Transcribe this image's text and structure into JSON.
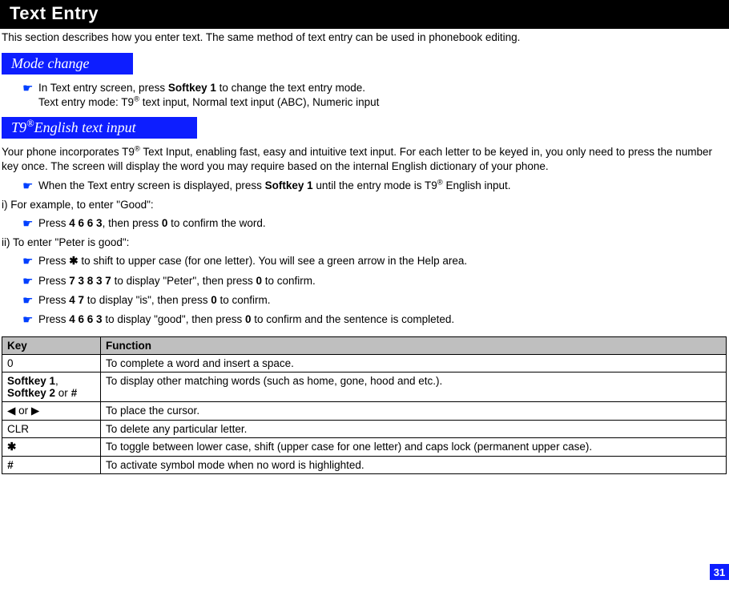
{
  "title": "Text Entry",
  "intro": "This section describes how you enter text. The same method of text entry can be used in phonebook editing.",
  "section1": {
    "heading": "Mode change"
  },
  "modechange": {
    "line1_a": "In Text entry screen, press ",
    "line1_b": "Softkey 1",
    "line1_c": " to change the text entry mode.",
    "line2": "Text entry mode: T9",
    "line2_sup": "®",
    "line2_tail": " text input, Normal text input (ABC), Numeric input"
  },
  "section2": {
    "heading_a": "T9",
    "heading_sup": "®",
    "heading_b": "English text input"
  },
  "t9_intro_a": "Your phone incorporates T9",
  "t9_intro_sup": "®",
  "t9_intro_b": " Text Input, enabling fast, easy and intuitive text input. For each letter to be keyed in, you only need to press the number key once. The screen will display the word you may require based on the internal English dictionary of your phone.",
  "t9_bullet1_a": "When the Text entry screen is displayed, press ",
  "t9_bullet1_b": "Softkey 1",
  "t9_bullet1_c": " until the entry mode is T9",
  "t9_bullet1_sup": "®",
  "t9_bullet1_d": " English input.",
  "ex_i": "i) For example, to enter \"Good\":",
  "ex_i_b1_a": " Press ",
  "ex_i_b1_b": "4 6 6 3",
  "ex_i_b1_c": ", then press ",
  "ex_i_b1_d": "0",
  "ex_i_b1_e": " to confirm the word.",
  "ex_ii": "ii) To enter \"Peter is good\":",
  "ex_ii_b1_a": "Press ",
  "ex_ii_b1_star": "✱",
  "ex_ii_b1_b": " to shift to upper case (for one letter). You will see a green arrow in the Help area.",
  "ex_ii_b2_a": "Press ",
  "ex_ii_b2_b": "7 3 8 3 7",
  "ex_ii_b2_c": " to display \"Peter\", then press ",
  "ex_ii_b2_d": "0",
  "ex_ii_b2_e": " to confirm.",
  "ex_ii_b3_a": "Press ",
  "ex_ii_b3_b": "4 7",
  "ex_ii_b3_c": " to display \"is\", then press ",
  "ex_ii_b3_d": "0",
  "ex_ii_b3_e": " to confirm.",
  "ex_ii_b4_a": "Press ",
  "ex_ii_b4_b": "4 6 6 3",
  "ex_ii_b4_c": " to display \"good\", then press ",
  "ex_ii_b4_d": "0",
  "ex_ii_b4_e": " to confirm and the sentence is completed.",
  "table": {
    "h_key": "Key",
    "h_func": "Function",
    "r0_k": "0",
    "r0_f": "To complete a word and insert a space.",
    "r1_k_a": "Softkey 1",
    "r1_k_b": "Softkey 2",
    "r1_k_sep": ", ",
    "r1_k_or": " or ",
    "r1_k_hash": "#",
    "r1_f": "To display other matching words (such as home, gone, hood and etc.).",
    "r2_k_left": "◀",
    "r2_k_or": " or ",
    "r2_k_right": "▶",
    "r2_f": "To place the cursor.",
    "r3_k": "CLR",
    "r3_f": "To delete any particular letter.",
    "r4_k": "✱",
    "r4_f": "To toggle between lower case, shift (upper case for one letter) and caps lock (permanent upper case).",
    "r5_k": "#",
    "r5_f": "To activate symbol mode when no word is highlighted."
  },
  "page_number": "31",
  "hand": "☛"
}
